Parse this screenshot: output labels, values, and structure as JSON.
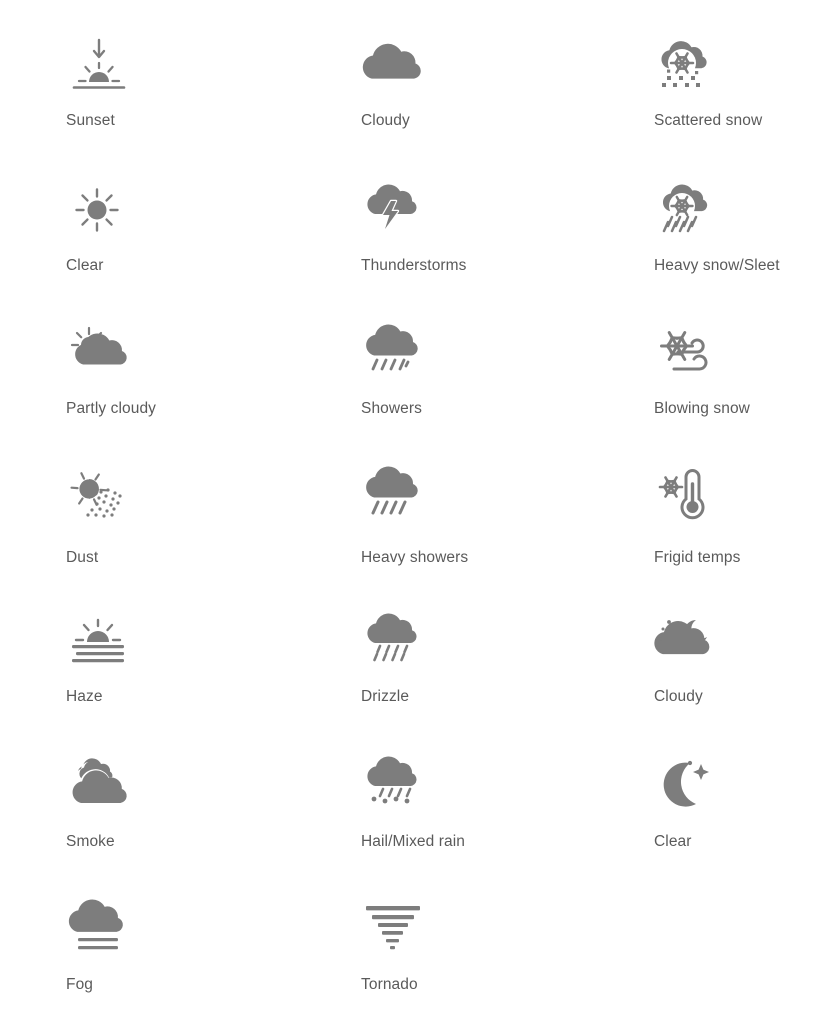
{
  "page": {
    "background_color": "#ffffff",
    "icon_color": "#7d7d7d",
    "label_color": "#5a5a5a",
    "columns": 3,
    "rows": 7,
    "total_icons": 20
  },
  "icons": [
    {
      "id": "sunset",
      "label": "Sunset",
      "glyph": "sunset-icon",
      "row": 1,
      "col": 1
    },
    {
      "id": "cloudy-day",
      "label": "Cloudy",
      "glyph": "cloud-icon",
      "row": 1,
      "col": 2
    },
    {
      "id": "scattered-snow",
      "label": "Scattered snow",
      "glyph": "cloud-snowflake-dots-icon",
      "row": 1,
      "col": 3
    },
    {
      "id": "clear-day",
      "label": "Clear",
      "glyph": "sun-icon",
      "row": 2,
      "col": 1
    },
    {
      "id": "thunderstorms",
      "label": "Thunderstorms",
      "glyph": "cloud-lightning-icon",
      "row": 2,
      "col": 2
    },
    {
      "id": "heavy-snow-sleet",
      "label": "Heavy snow/Sleet",
      "glyph": "cloud-snowflake-rain-icon",
      "row": 2,
      "col": 3
    },
    {
      "id": "partly-cloudy",
      "label": "Partly cloudy",
      "glyph": "sun-behind-cloud-icon",
      "row": 3,
      "col": 1
    },
    {
      "id": "showers",
      "label": "Showers",
      "glyph": "cloud-rain-icon",
      "row": 3,
      "col": 2
    },
    {
      "id": "blowing-snow",
      "label": "Blowing snow",
      "glyph": "snowflake-wind-icon",
      "row": 3,
      "col": 3
    },
    {
      "id": "dust",
      "label": "Dust",
      "glyph": "sun-dust-icon",
      "row": 4,
      "col": 1
    },
    {
      "id": "heavy-showers",
      "label": "Heavy showers",
      "glyph": "cloud-heavy-rain-icon",
      "row": 4,
      "col": 2
    },
    {
      "id": "frigid-temps",
      "label": "Frigid temps",
      "glyph": "thermometer-snowflake-icon",
      "row": 4,
      "col": 3
    },
    {
      "id": "haze",
      "label": "Haze",
      "glyph": "haze-icon",
      "row": 5,
      "col": 1
    },
    {
      "id": "drizzle",
      "label": "Drizzle",
      "glyph": "cloud-drizzle-icon",
      "row": 5,
      "col": 2
    },
    {
      "id": "cloudy-night",
      "label": "Cloudy",
      "glyph": "moon-behind-cloud-icon",
      "row": 5,
      "col": 3
    },
    {
      "id": "smoke",
      "label": "Smoke",
      "glyph": "double-cloud-icon",
      "row": 6,
      "col": 1
    },
    {
      "id": "hail-mixed-rain",
      "label": "Hail/Mixed rain",
      "glyph": "cloud-hail-icon",
      "row": 6,
      "col": 2
    },
    {
      "id": "clear-night",
      "label": "Clear",
      "glyph": "crescent-moon-icon",
      "row": 6,
      "col": 3
    },
    {
      "id": "fog",
      "label": "Fog",
      "glyph": "cloud-fog-icon",
      "row": 7,
      "col": 1
    },
    {
      "id": "tornado",
      "label": "Tornado",
      "glyph": "tornado-icon",
      "row": 7,
      "col": 2
    }
  ]
}
